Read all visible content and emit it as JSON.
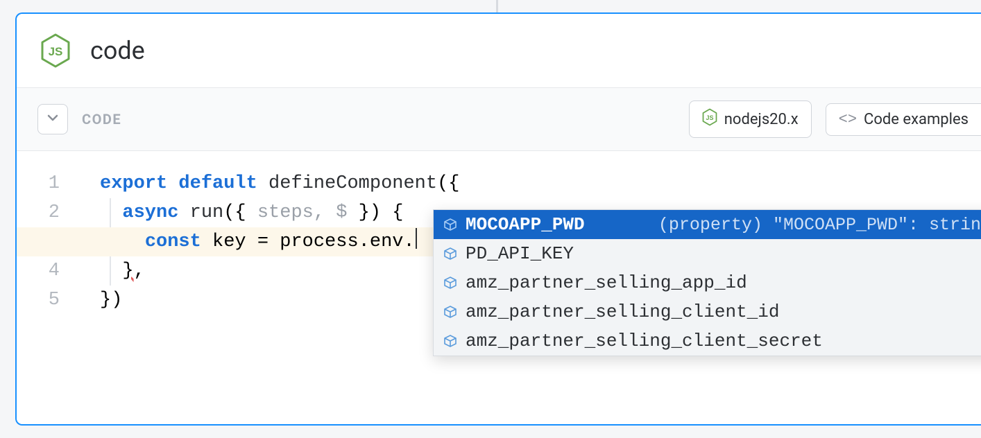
{
  "header": {
    "title": "code"
  },
  "toolbar": {
    "label": "CODE",
    "runtime": "nodejs20.x",
    "examples_label": "Code examples"
  },
  "editor": {
    "lines": [
      "1",
      "2",
      "3",
      "4",
      "5"
    ],
    "active_line_index": 2,
    "code": {
      "l1": {
        "kw_export": "export",
        "kw_default": "default",
        "fn": "defineComponent",
        "tail": "({"
      },
      "l2": {
        "indent": "  ",
        "kw_async": "async",
        "fn": "run",
        "params_open": "({ ",
        "params_inner": "steps, $",
        "params_close": " }) {"
      },
      "l3": {
        "indent": "    ",
        "kw_const": "const",
        "rest": " key = process.env."
      },
      "l4": {
        "indent": "  ",
        "brace": "}",
        "comma": ","
      },
      "l5": {
        "text": "})"
      }
    }
  },
  "autocomplete": {
    "items": [
      {
        "name": "MOCOAPP_PWD",
        "detail": "(property) \"MOCOAPP_PWD\": string",
        "selected": true
      },
      {
        "name": "PD_API_KEY",
        "selected": false
      },
      {
        "name": "amz_partner_selling_app_id",
        "selected": false
      },
      {
        "name": "amz_partner_selling_client_id",
        "selected": false
      },
      {
        "name": "amz_partner_selling_client_secret",
        "selected": false
      }
    ]
  }
}
